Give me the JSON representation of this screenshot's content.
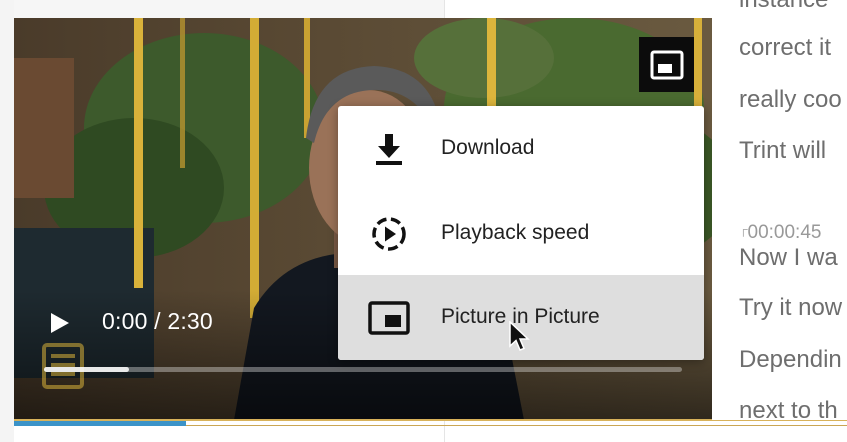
{
  "player": {
    "time_display": "0:00 / 2:30",
    "progress": {
      "current_seconds": 0,
      "duration_seconds": 150
    }
  },
  "context_menu": {
    "items": [
      {
        "label": "Download",
        "icon": "download-icon"
      },
      {
        "label": "Playback speed",
        "icon": "playback-speed-icon"
      },
      {
        "label": "Picture in Picture",
        "icon": "picture-in-picture-icon",
        "highlighted": true
      }
    ]
  },
  "transcript": {
    "lines": [
      {
        "text": "instance"
      },
      {
        "text": "correct it"
      },
      {
        "text": "really coo"
      },
      {
        "text": "Trint will"
      }
    ],
    "timestamp": "00:00:45",
    "timestamp_bracket": "┌",
    "lines_after": [
      {
        "text": "Now I wa"
      },
      {
        "text": "Try it now"
      },
      {
        "text": "Dependin"
      },
      {
        "text": "next to th"
      }
    ]
  },
  "colors": {
    "timeline_accent": "#d8b25a",
    "timeline_progress": "#3b93c8",
    "menu_highlight": "#dedede"
  }
}
